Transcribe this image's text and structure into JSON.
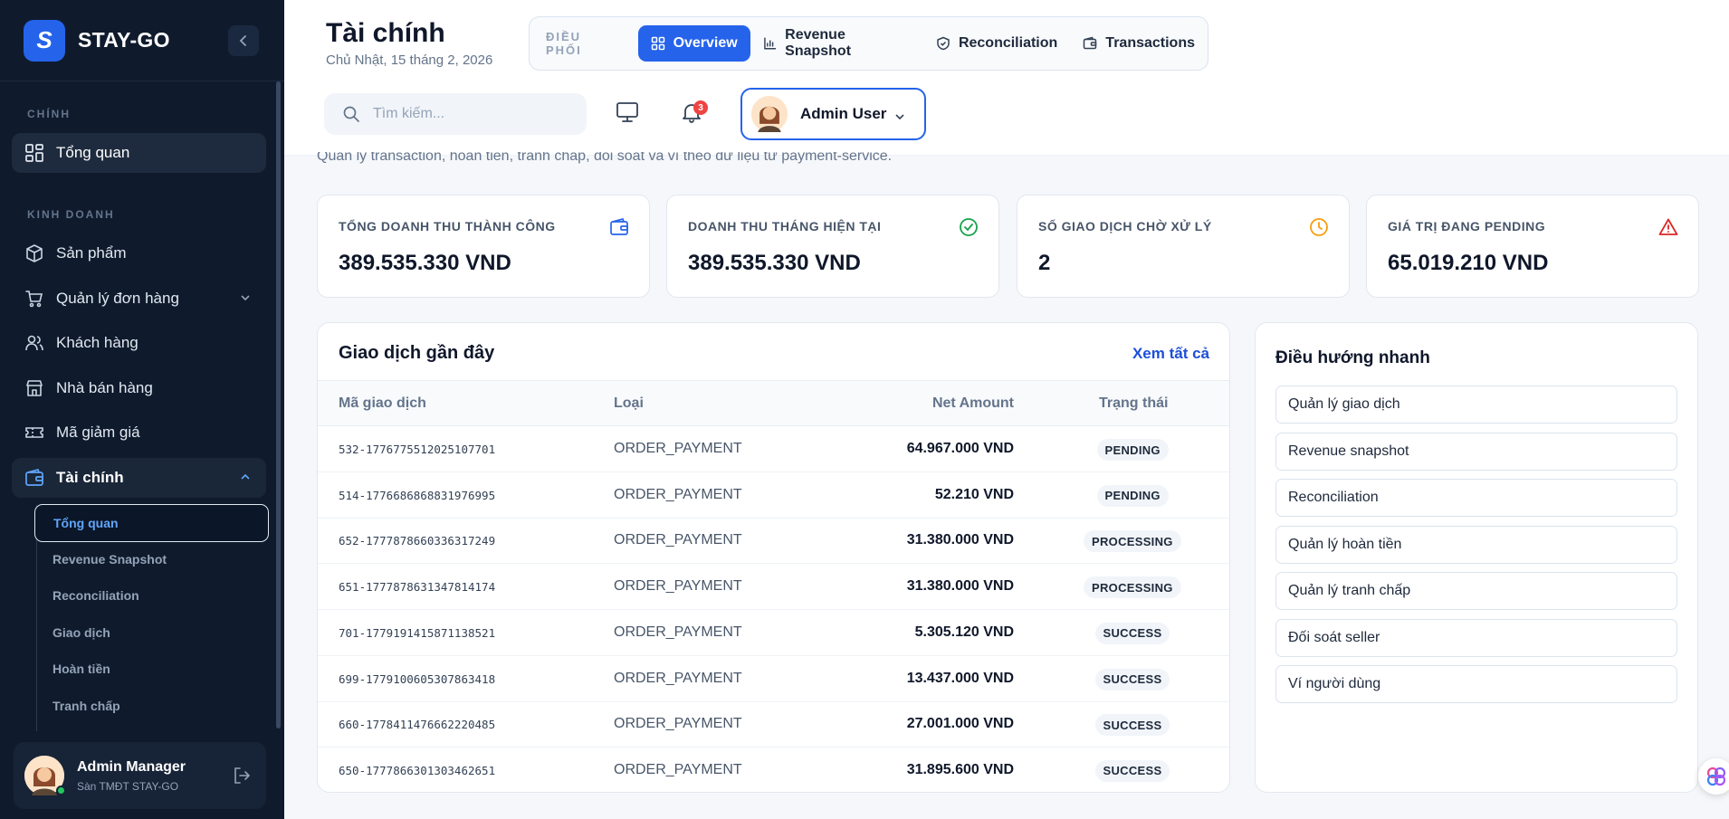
{
  "sidebar": {
    "brand_letter": "S",
    "brand": "STAY-GO",
    "section_main": "CHÍNH",
    "section_business": "KINH DOANH",
    "items": {
      "overview": "Tổng quan",
      "products": "Sản phẩm",
      "orders": "Quản lý đơn hàng",
      "customers": "Khách hàng",
      "sellers": "Nhà bán hàng",
      "coupons": "Mã giảm giá",
      "finance": "Tài chính"
    },
    "finance_sub": {
      "overview": "Tổng quan",
      "revenue": "Revenue Snapshot",
      "reconciliation": "Reconciliation",
      "transactions": "Giao dịch",
      "refunds": "Hoàn tiền",
      "disputes": "Tranh chấp"
    },
    "user": {
      "name": "Admin Manager",
      "subtitle": "Sàn TMĐT STAY-GO"
    }
  },
  "header": {
    "title": "Tài chính",
    "date": "Chủ Nhật, 15 tháng 2, 2026",
    "tabs_label": "ĐIỀU PHỐI",
    "tabs": {
      "overview": "Overview",
      "revenue": "Revenue Snapshot",
      "reconciliation": "Reconciliation",
      "transactions": "Transactions"
    },
    "search_placeholder": "Tìm kiếm...",
    "notification_count": "3",
    "user_name": "Admin User"
  },
  "description": "Quản lý transaction, hoàn tiền, tranh chấp, đối soát và ví theo dữ liệu từ payment-service.",
  "stats": {
    "total_revenue": {
      "label": "TỔNG DOANH THU THÀNH CÔNG",
      "value": "389.535.330 VND"
    },
    "month_revenue": {
      "label": "DOANH THU THÁNG HIỆN TẠI",
      "value": "389.535.330 VND"
    },
    "pending_count": {
      "label": "SỐ GIAO DỊCH CHỜ XỬ LÝ",
      "value": "2"
    },
    "pending_value": {
      "label": "GIÁ TRỊ ĐANG PENDING",
      "value": "65.019.210 VND"
    }
  },
  "transactions": {
    "title": "Giao dịch gần đây",
    "view_all": "Xem tất cả",
    "columns": {
      "id": "Mã giao dịch",
      "type": "Loại",
      "amount": "Net Amount",
      "status": "Trạng thái"
    },
    "rows": [
      {
        "id": "532-1776775512025107701",
        "type": "ORDER_PAYMENT",
        "amount": "64.967.000 VND",
        "status": "PENDING"
      },
      {
        "id": "514-1776686868831976995",
        "type": "ORDER_PAYMENT",
        "amount": "52.210 VND",
        "status": "PENDING"
      },
      {
        "id": "652-1777878660336317249",
        "type": "ORDER_PAYMENT",
        "amount": "31.380.000 VND",
        "status": "PROCESSING"
      },
      {
        "id": "651-1777878631347814174",
        "type": "ORDER_PAYMENT",
        "amount": "31.380.000 VND",
        "status": "PROCESSING"
      },
      {
        "id": "701-1779191415871138521",
        "type": "ORDER_PAYMENT",
        "amount": "5.305.120 VND",
        "status": "SUCCESS"
      },
      {
        "id": "699-1779100605307863418",
        "type": "ORDER_PAYMENT",
        "amount": "13.437.000 VND",
        "status": "SUCCESS"
      },
      {
        "id": "660-1778411476662220485",
        "type": "ORDER_PAYMENT",
        "amount": "27.001.000 VND",
        "status": "SUCCESS"
      },
      {
        "id": "650-1777866301303462651",
        "type": "ORDER_PAYMENT",
        "amount": "31.895.600 VND",
        "status": "SUCCESS"
      }
    ]
  },
  "quick_nav": {
    "title": "Điều hướng nhanh",
    "items": [
      "Quản lý giao dịch",
      "Revenue snapshot",
      "Reconciliation",
      "Quản lý hoàn tiền",
      "Quản lý tranh chấp",
      "Đối soát seller",
      "Ví người dùng"
    ]
  },
  "colors": {
    "sidebar_bg": "#0f1b2d",
    "accent": "#2563eb",
    "success_icon": "#16a34a",
    "pending_icon": "#f59e0b",
    "warning_icon": "#dc2626"
  }
}
